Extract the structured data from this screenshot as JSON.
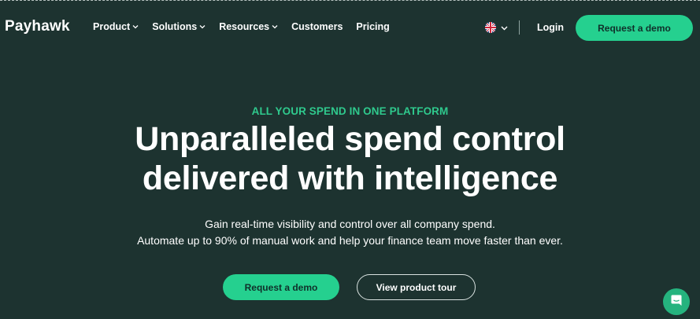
{
  "brand": {
    "logo_text": "Payhawk"
  },
  "nav": {
    "items": [
      {
        "label": "Product",
        "has_dropdown": true
      },
      {
        "label": "Solutions",
        "has_dropdown": true
      },
      {
        "label": "Resources",
        "has_dropdown": true
      },
      {
        "label": "Customers",
        "has_dropdown": false
      },
      {
        "label": "Pricing",
        "has_dropdown": false
      }
    ],
    "language_icon": "uk-flag-icon",
    "login_label": "Login",
    "cta_label": "Request a demo"
  },
  "hero": {
    "eyebrow": "ALL YOUR SPEND IN ONE PLATFORM",
    "headline_line1": "Unparalleled spend control",
    "headline_line2": "delivered with intelligence",
    "subtext_line1": "Gain real-time visibility and control over all company spend.",
    "subtext_line2": "Automate up to 90% of manual work and help your finance team move faster than ever.",
    "primary_cta": "Request a demo",
    "secondary_cta": "View product tour"
  },
  "chat_widget": {
    "icon": "chat-bubble-icon"
  },
  "colors": {
    "background": "#1d3330",
    "accent": "#25d08f",
    "eyebrow": "#2fc98d",
    "text": "#ffffff"
  }
}
